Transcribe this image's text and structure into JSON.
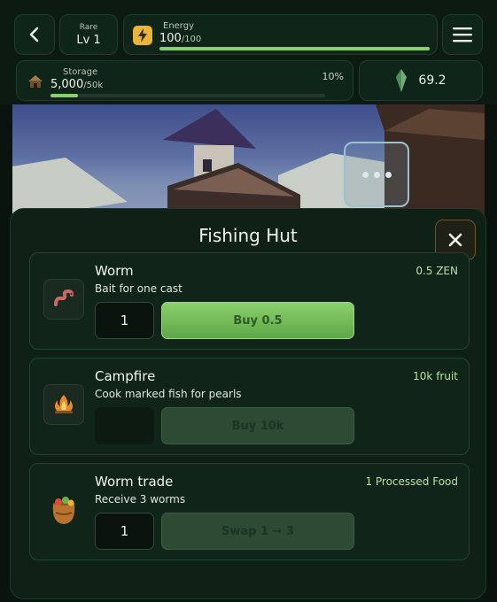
{
  "header": {
    "rarity": "Rare",
    "level": "Lv 1",
    "energy": {
      "label": "Energy",
      "value": "100",
      "max": "/100",
      "fraction": 1.0
    },
    "storage": {
      "label": "Storage",
      "value": "5,000",
      "max": "/50k",
      "percent_label": "10%",
      "fraction": 0.1
    },
    "zen_balance": "69.2"
  },
  "icons": {
    "back": "chevron-left-icon",
    "energy": "lightning-icon",
    "menu": "hamburger-icon",
    "storage": "hut-icon",
    "zen": "crystal-icon",
    "more": "more-dots-icon",
    "close": "close-icon"
  },
  "colors": {
    "accent_green": "#8ccf6a",
    "price_green": "#b6e29c",
    "energy_icon": "#e8b53a"
  },
  "modal": {
    "title": "Fishing Hut",
    "items": [
      {
        "name": "Worm",
        "description": "Bait for one cast",
        "price": "0.5 ZEN",
        "quantity": "1",
        "action_label": "Buy 0.5",
        "icon": "worm-icon",
        "action_enabled": true
      },
      {
        "name": "Campfire",
        "description": "Cook marked fish for pearls",
        "price": "10k fruit",
        "quantity": "",
        "action_label": "Buy 10k",
        "icon": "campfire-icon",
        "action_enabled": false
      },
      {
        "name": "Worm trade",
        "description": "Receive 3 worms",
        "price": "1 Processed Food",
        "quantity": "1",
        "action_label": "Swap 1 → 3",
        "icon": "food-bag-icon",
        "action_enabled": false
      }
    ]
  }
}
